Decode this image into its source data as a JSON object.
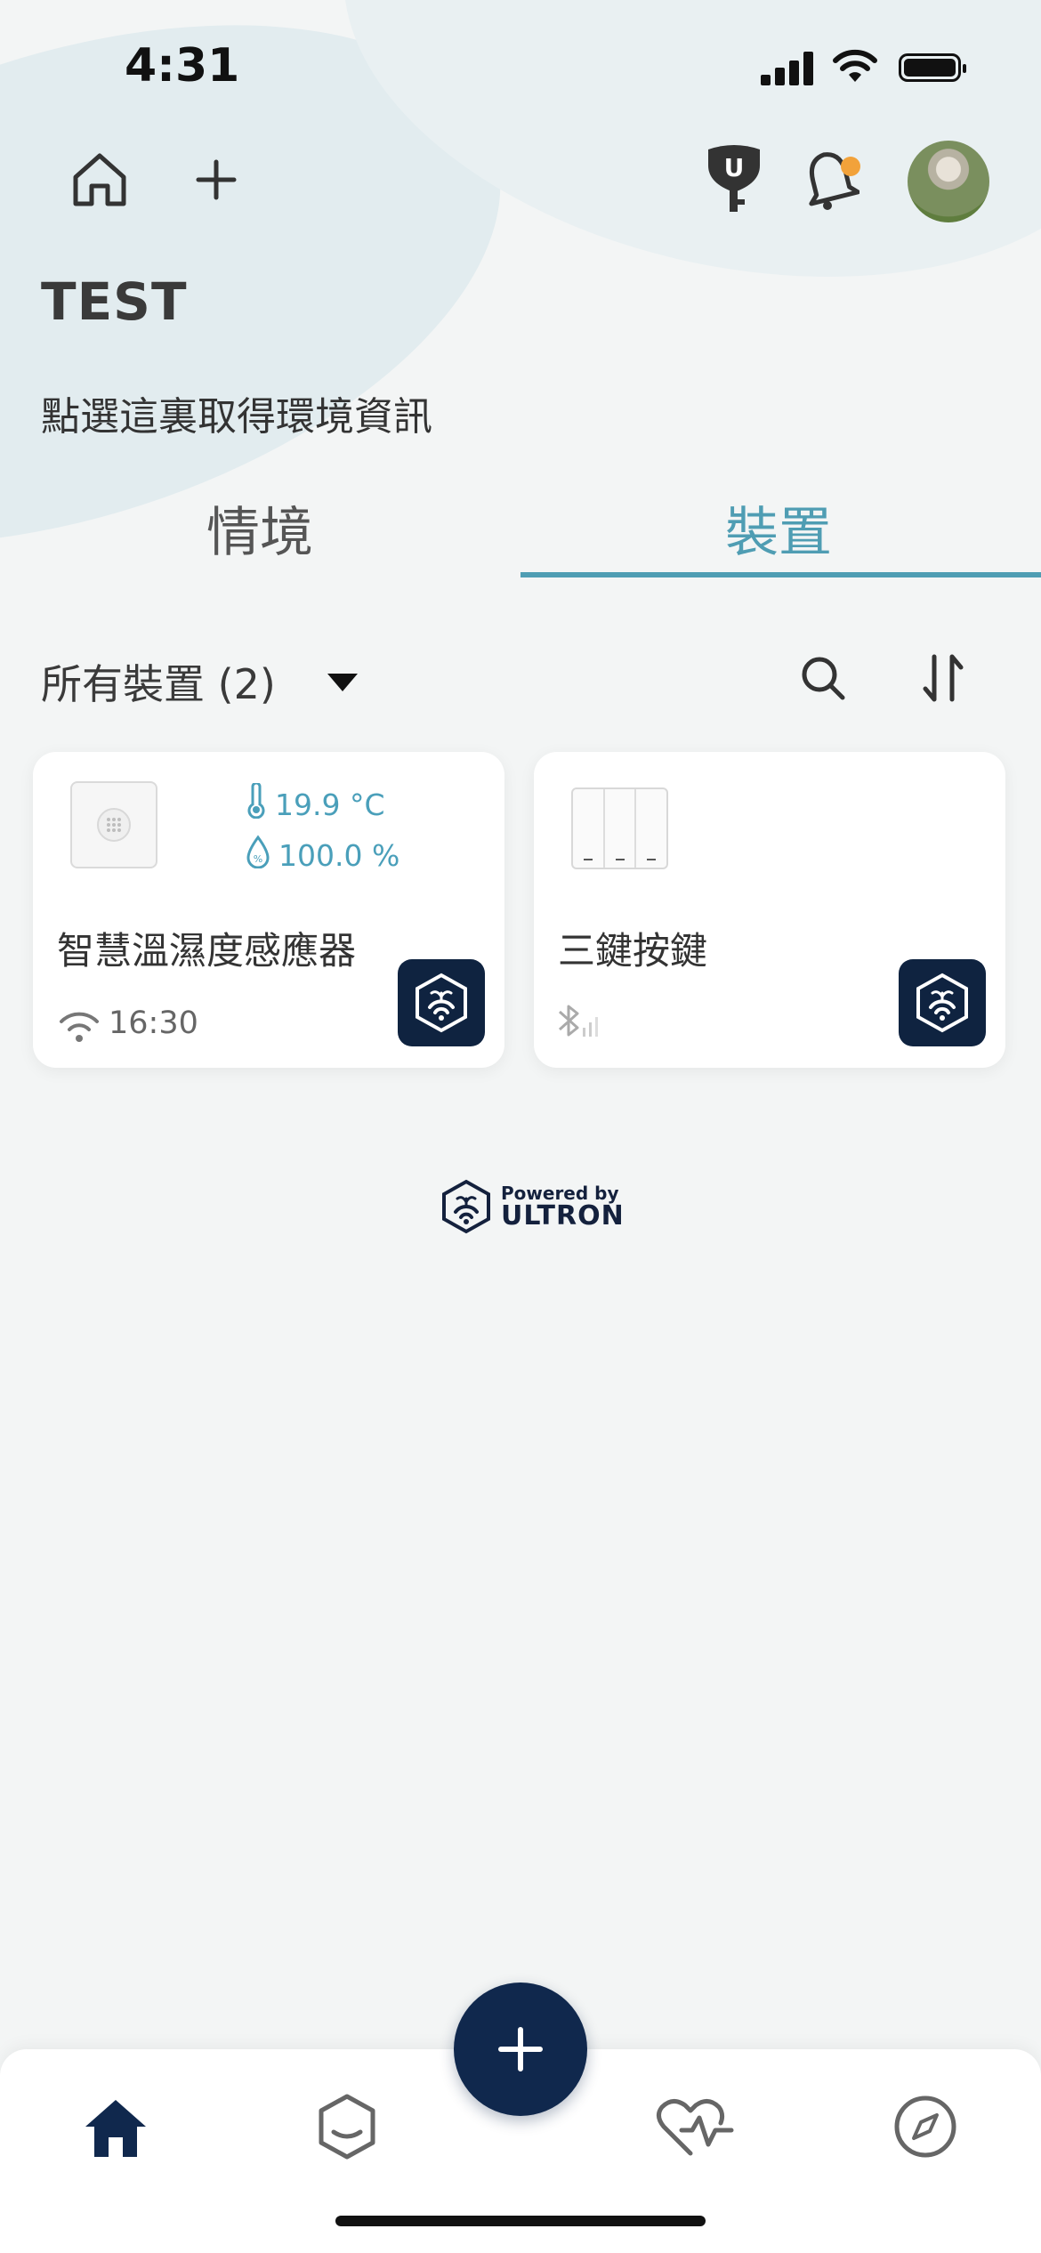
{
  "status_bar": {
    "time": "4:31"
  },
  "header": {
    "home_title": "TEST",
    "env_hint": "點選這裏取得環境資訊"
  },
  "tabs": [
    {
      "label": "情境",
      "active": false
    },
    {
      "label": "裝置",
      "active": true
    }
  ],
  "filter": {
    "label": "所有裝置 (2)"
  },
  "devices": [
    {
      "name": "智慧溫濕度感應器",
      "temperature": "19.9 °C",
      "humidity": "100.0 %",
      "connection": "wifi",
      "last_seen": "16:30"
    },
    {
      "name": "三鍵按鍵",
      "connection": "bluetooth"
    }
  ],
  "powered_by": {
    "small": "Powered by",
    "brand": "ULTRON"
  },
  "colors": {
    "accent": "#4f9db3",
    "navy": "#10284d",
    "notification": "#f2a23a"
  },
  "icons": {
    "header": [
      "home-icon",
      "plus-icon",
      "key-icon",
      "bell-icon"
    ],
    "filter": [
      "search-icon",
      "sort-icon"
    ],
    "nav": [
      "home-icon",
      "hexagon-icon",
      "plus-icon",
      "heart-pulse-icon",
      "compass-icon"
    ]
  }
}
